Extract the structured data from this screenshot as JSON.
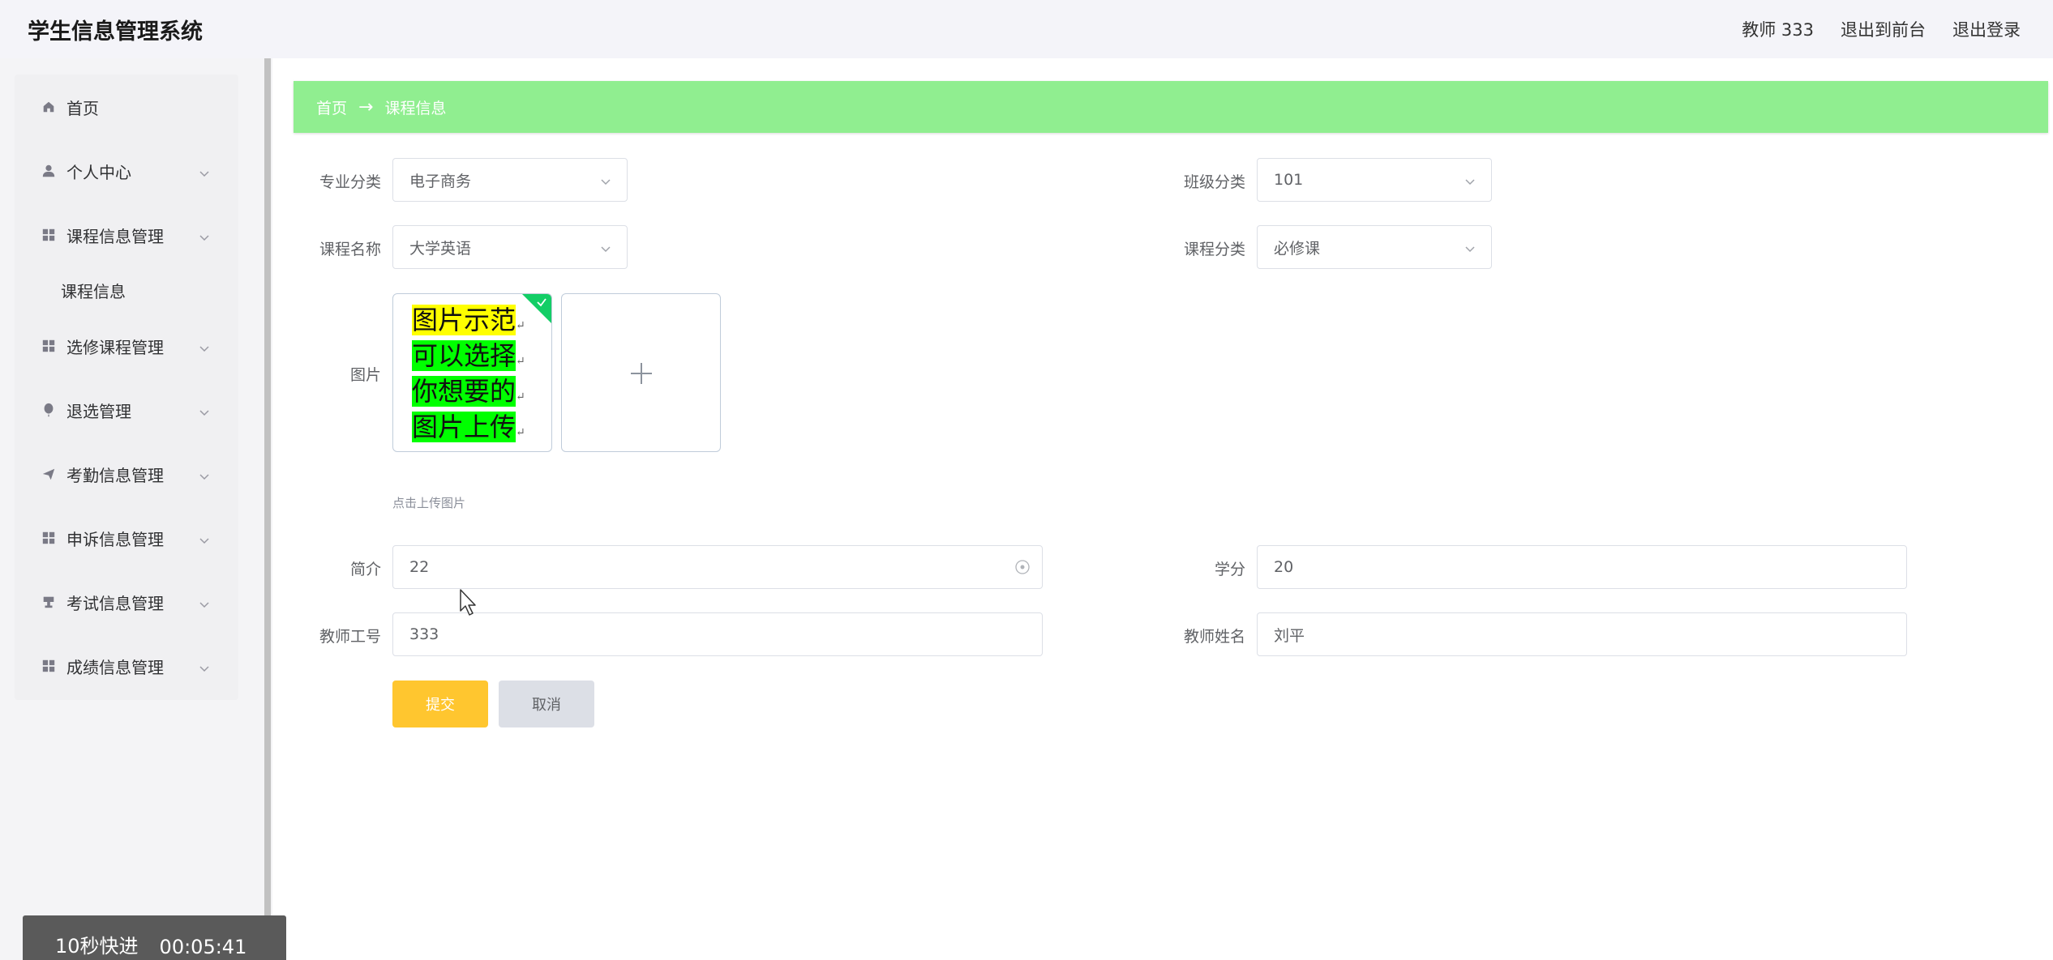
{
  "header": {
    "title": "学生信息管理系统",
    "user": "教师 333",
    "back_to_front": "退出到前台",
    "logout": "退出登录"
  },
  "sidebar": {
    "items": [
      {
        "label": "首页",
        "icon": "home-icon"
      },
      {
        "label": "个人中心",
        "icon": "user-icon"
      },
      {
        "label": "课程信息管理",
        "icon": "grid-icon"
      },
      {
        "label": "课程信息"
      },
      {
        "label": "选修课程管理",
        "icon": "grid-icon"
      },
      {
        "label": "退选管理",
        "icon": "balloon-icon"
      },
      {
        "label": "考勤信息管理",
        "icon": "send-icon"
      },
      {
        "label": "申诉信息管理",
        "icon": "grid-icon"
      },
      {
        "label": "考试信息管理",
        "icon": "cup-icon"
      },
      {
        "label": "成绩信息管理",
        "icon": "grid-icon"
      }
    ]
  },
  "breadcrumb": {
    "home": "首页",
    "separator": "→",
    "current": "课程信息",
    "bg_color": "#90ee90"
  },
  "form": {
    "major": {
      "label": "专业分类",
      "value": "电子商务"
    },
    "class": {
      "label": "班级分类",
      "value": "101"
    },
    "course_name": {
      "label": "课程名称",
      "value": "大学英语"
    },
    "course_type": {
      "label": "课程分类",
      "value": "必修课"
    },
    "image": {
      "label": "图片",
      "thumb_lines": [
        "图片示范",
        "可以选择",
        "你想要的",
        "图片上传"
      ],
      "tip": "点击上传图片"
    },
    "intro": {
      "label": "简介",
      "value": "22"
    },
    "credit": {
      "label": "学分",
      "value": "20"
    },
    "teacher_id": {
      "label": "教师工号",
      "value": "333"
    },
    "teacher_name": {
      "label": "教师姓名",
      "value": "刘平"
    },
    "submit": "提交",
    "cancel": "取消"
  },
  "overlay": {
    "label": "10秒快进",
    "time": "00:05:41"
  },
  "colors": {
    "submit": "#ffc62f",
    "success": "#13ce66"
  }
}
